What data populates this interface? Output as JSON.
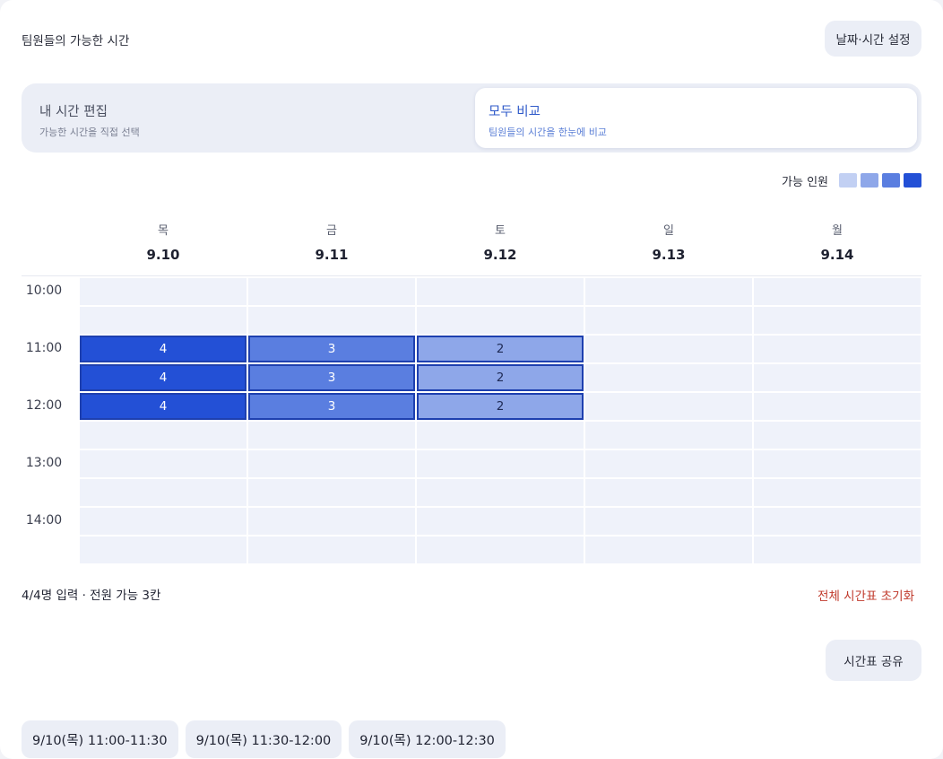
{
  "header": {
    "title": "팀원들의 가능한 시간",
    "settings_label": "날짜·시간 설정"
  },
  "mode_toggle": {
    "edit": {
      "title": "내 시간 편집",
      "subtitle": "가능한 시간을 직접 선택"
    },
    "compare": {
      "title": "모두 비교",
      "subtitle": "팀원들의 시간을 한눈에 비교"
    },
    "selected": "compare"
  },
  "legend": {
    "label": "가능 인원",
    "colors": [
      "#c2d0f3",
      "#8ea7e9",
      "#5a7ee0",
      "#2350d6"
    ]
  },
  "days": [
    {
      "dow": "목",
      "date": "9.10"
    },
    {
      "dow": "금",
      "date": "9.11"
    },
    {
      "dow": "토",
      "date": "9.12"
    },
    {
      "dow": "일",
      "date": "9.13"
    },
    {
      "dow": "월",
      "date": "9.14"
    }
  ],
  "time_labels": [
    "10:00",
    "11:00",
    "12:00",
    "13:00",
    "14:00"
  ],
  "grid": {
    "rows": 10,
    "availability": [
      [
        0,
        0,
        4,
        4,
        4,
        0,
        0,
        0,
        0,
        0
      ],
      [
        0,
        0,
        3,
        3,
        3,
        0,
        0,
        0,
        0,
        0
      ],
      [
        0,
        0,
        2,
        2,
        2,
        0,
        0,
        0,
        0,
        0
      ],
      [
        0,
        0,
        0,
        0,
        0,
        0,
        0,
        0,
        0,
        0
      ],
      [
        0,
        0,
        0,
        0,
        0,
        0,
        0,
        0,
        0,
        0
      ]
    ],
    "cell_colors": {
      "empty": "#eff2fa",
      "1": "#c2d0f3",
      "2": "#8ea7e9",
      "3": "#5a7ee0",
      "4": "#2350d6"
    }
  },
  "summary": {
    "text": "4/4명 입력 · 전원 가능 3칸",
    "reset_label": "전체 시간표 초기화"
  },
  "share_label": "시간표 공유",
  "slots": [
    "9/10(목) 11:00-11:30",
    "9/10(목) 11:30-12:00",
    "9/10(목) 12:00-12:30"
  ]
}
